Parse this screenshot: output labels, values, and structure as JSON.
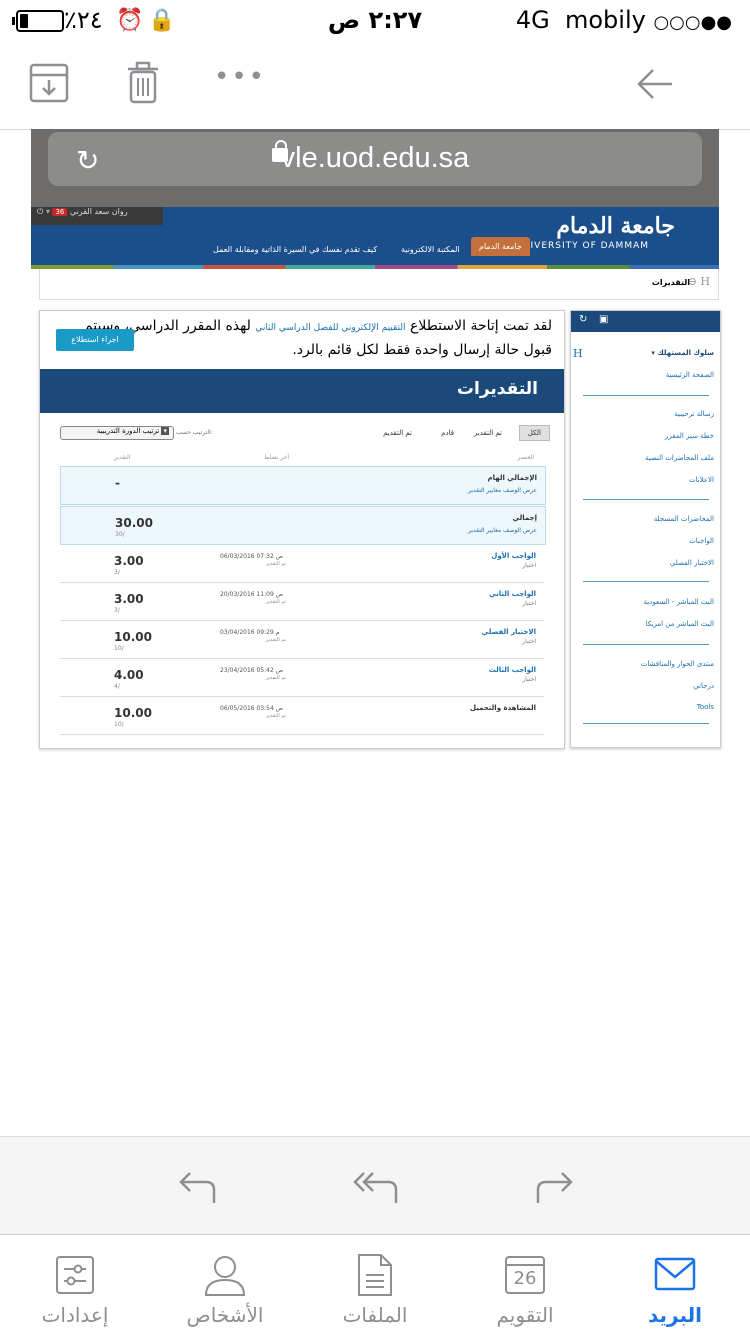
{
  "status_bar": {
    "carrier": "mobily",
    "network": "4G",
    "signal": "○○○●●",
    "time": "٢:٢٧ ص",
    "battery_percent": "٪٢٤"
  },
  "browser": {
    "url": "vle.uod.edu.sa"
  },
  "university": {
    "logo_ar": "جامعة الدمام",
    "logo_en": "UNIVERSITY OF DAMMAM",
    "user": "روان سعد القرني",
    "badge": "36",
    "nav": [
      "جامعة الدمام",
      "المكتبة الالكترونية",
      "كيف تقدم نفسك في السيرة الذاتية ومقابلة العمل"
    ]
  },
  "breadcrumb": "التقديرات",
  "notice": {
    "text_start": "لقد تمت إتاحة الاستطلاع ",
    "link": "التقييم الإلكتروني للفصل الدراسي الثاني",
    "text_end": " لهذه المقرر الدراسي، وسيتم قبول حالة إرسال واحدة فقط لكل قائم بالرد.",
    "button": "اجراء استطلاع"
  },
  "grades": {
    "title": "التقديرات",
    "filters": [
      "الكل",
      "تم التقدير",
      "قادم",
      "تم التقديم"
    ],
    "sort_label": "الترتيب حسب:",
    "sort_value": "ترتيب الدورة التدريبية",
    "headers": {
      "item": "العنصر",
      "activity": "آخر نشاط",
      "grade": "التقدير"
    },
    "rows": [
      {
        "name": "الإجمالي الهام",
        "links": "عرض الوصف  معايير التقدير",
        "score": "-",
        "outof": "",
        "date": "",
        "status": ""
      },
      {
        "name": "إجمالي",
        "links": "عرض الوصف  معايير التقدير",
        "score": "30.00",
        "outof": "30/",
        "date": "",
        "status": ""
      },
      {
        "name": "الواجب الأول",
        "sub": "اختبار",
        "score": "3.00",
        "outof": "3/",
        "date": "06/03/2016 07:32 ص",
        "status": "تم التقدير"
      },
      {
        "name": "الواجب الثاني",
        "sub": "اختبار",
        "score": "3.00",
        "outof": "3/",
        "date": "20/03/2016 11:09 ص",
        "status": "تم التقدير"
      },
      {
        "name": "الاختبار الفصلي",
        "sub": "اختبار",
        "score": "10.00",
        "outof": "10/",
        "date": "03/04/2016 09:29 م",
        "status": "تم التقدير"
      },
      {
        "name": "الواجب الثالث",
        "sub": "اختبار",
        "score": "4.00",
        "outof": "4/",
        "date": "23/04/2016 05:42 ص",
        "status": "تم التقدير"
      },
      {
        "name": "المشاهدة والتحميل",
        "sub": "",
        "score": "10.00",
        "outof": "10/",
        "date": "06/05/2016 03:54 ص",
        "status": "تم التقدير"
      }
    ]
  },
  "sidebar": {
    "course": "سلوك المستهلك",
    "items_a": [
      "الصفحة الرئيسية"
    ],
    "items_b": [
      "رسالة ترحيبية",
      "خطة سير المقرر",
      "ملف المحاضرات النصية",
      "الاعلانات"
    ],
    "items_c": [
      "المحاضرات المسجلة",
      "الواجبات",
      "الاختبار الفصلي"
    ],
    "items_d": [
      "البث المباشر - السعودية",
      "البث المباشر من امريكا"
    ],
    "items_e": [
      "منتدى الحوار والمناقشات",
      "درجاتي",
      "Tools"
    ]
  },
  "tabs": [
    {
      "label": "إعدادات",
      "icon": "settings-sliders-icon"
    },
    {
      "label": "الأشخاص",
      "icon": "person-icon"
    },
    {
      "label": "الملفات",
      "icon": "document-icon"
    },
    {
      "label": "التقويم",
      "icon": "calendar-icon",
      "day": "26"
    },
    {
      "label": "البريد",
      "icon": "mail-icon"
    }
  ],
  "colors": {
    "accent": "#1a73e8",
    "header_blue": "#1b4f8c",
    "gray_icon": "#8e8e93"
  }
}
